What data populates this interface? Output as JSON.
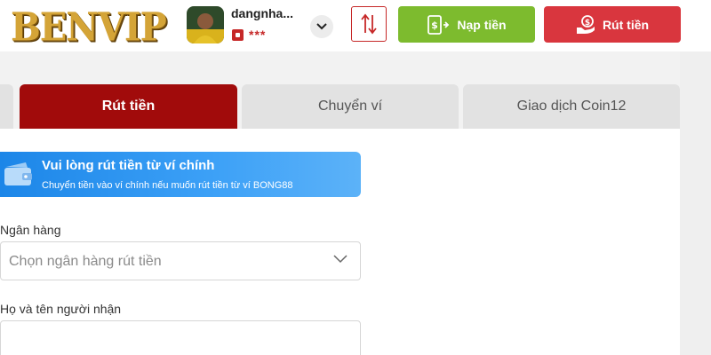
{
  "header": {
    "logo_text": "BENVIP",
    "username": "dangnha...",
    "balance_masked": "***",
    "deposit_label": "Nạp tiền",
    "withdraw_label": "Rút tiền"
  },
  "tabs": [
    {
      "label": "Rút tiền",
      "active": true
    },
    {
      "label": "Chuyển ví",
      "active": false
    },
    {
      "label": "Giao dịch Coin12",
      "active": false
    }
  ],
  "banner": {
    "title": "Vui lòng rút tiền từ ví chính",
    "subtitle": "Chuyển tiền vào ví chính nếu muốn rút tiền từ ví BONG88"
  },
  "form": {
    "bank_label": "Ngân hàng",
    "bank_placeholder": "Chọn ngân hàng rút tiền",
    "recipient_label": "Họ và tên người nhận",
    "recipient_value": ""
  },
  "icons": {
    "avatar": "user-avatar",
    "wallet": "wallet-icon",
    "dropdown": "chevron-down-icon",
    "transfer": "transfer-arrows-icon",
    "deposit": "deposit-icon",
    "withdraw": "withdraw-coin-icon",
    "banner": "wallet-banner-icon"
  },
  "colors": {
    "accent_red": "#a10b0b",
    "withdraw_red": "#d9363e",
    "deposit_green": "#7dbb2e",
    "banner_blue": "#1c86e8",
    "logo_gold": "#d4a437"
  }
}
